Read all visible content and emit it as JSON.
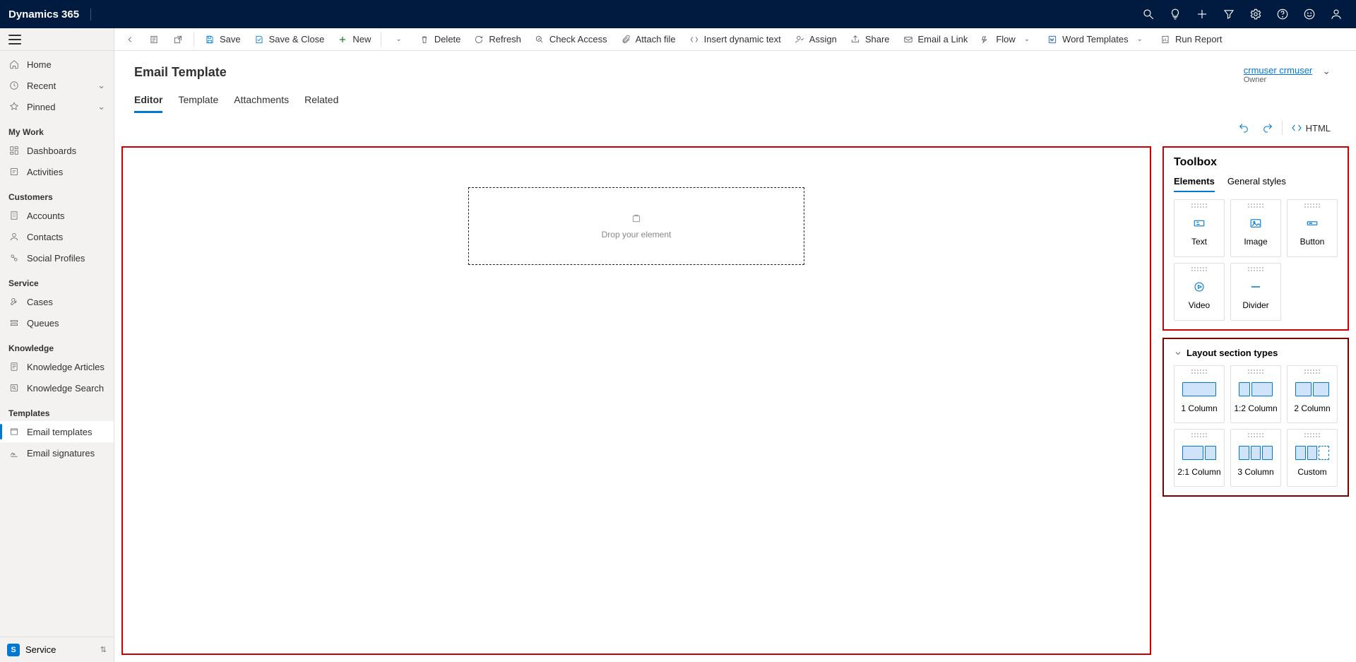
{
  "topbar": {
    "title": "Dynamics 365"
  },
  "cmdbar": {
    "save": "Save",
    "saveclose": "Save & Close",
    "new": "New",
    "delete": "Delete",
    "refresh": "Refresh",
    "checkaccess": "Check Access",
    "attach": "Attach file",
    "dynamic": "Insert dynamic text",
    "assign": "Assign",
    "share": "Share",
    "emaillink": "Email a Link",
    "flow": "Flow",
    "wordtemplates": "Word Templates",
    "runreport": "Run Report"
  },
  "sidebar": {
    "home": "Home",
    "recent": "Recent",
    "pinned": "Pinned",
    "sections": {
      "mywork": "My Work",
      "customers": "Customers",
      "service": "Service",
      "knowledge": "Knowledge",
      "templates": "Templates"
    },
    "items": {
      "dashboards": "Dashboards",
      "activities": "Activities",
      "accounts": "Accounts",
      "contacts": "Contacts",
      "socialprofiles": "Social Profiles",
      "cases": "Cases",
      "queues": "Queues",
      "karticles": "Knowledge Articles",
      "ksearch": "Knowledge Search",
      "emailtemplates": "Email templates",
      "emailsignatures": "Email signatures"
    },
    "app": {
      "badge": "S",
      "name": "Service"
    }
  },
  "record": {
    "title": "Email Template",
    "owner_name": "crmuser crmuser",
    "owner_label": "Owner"
  },
  "tabs": {
    "editor": "Editor",
    "template": "Template",
    "attachments": "Attachments",
    "related": "Related"
  },
  "editor": {
    "html": "HTML",
    "drop": "Drop your element"
  },
  "toolbox": {
    "title": "Toolbox",
    "elements_tab": "Elements",
    "styles_tab": "General styles",
    "text": "Text",
    "image": "Image",
    "button": "Button",
    "video": "Video",
    "divider": "Divider"
  },
  "layout": {
    "title": "Layout section types",
    "col1": "1 Column",
    "col12": "1:2 Column",
    "col2": "2 Column",
    "col21": "2:1 Column",
    "col3": "3 Column",
    "custom": "Custom"
  }
}
